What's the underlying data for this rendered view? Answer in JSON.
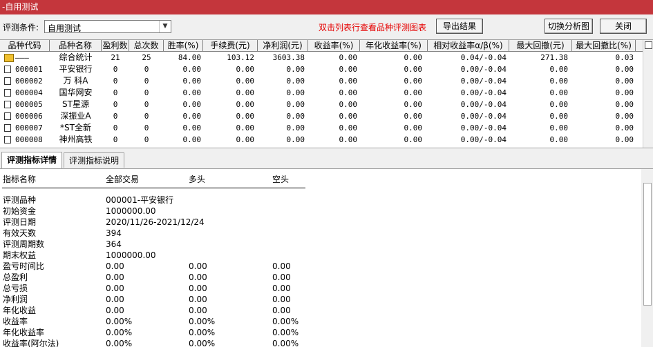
{
  "window": {
    "title": "-自用测试"
  },
  "toolbar": {
    "condition_label": "评测条件:",
    "condition_value": "自用测试",
    "hint": "双击列表行查看品种评测图表",
    "export_label": "导出结果",
    "switch_label": "切换分析图",
    "close_label": "关闭"
  },
  "table": {
    "columns": [
      "品种代码",
      "品种名称",
      "盈利数",
      "总次数",
      "胜率(%)",
      "手续费(元)",
      "净利润(元)",
      "收益率(%)",
      "年化收益率(%)",
      "相对收益率α/β(%)",
      "最大回撤(元)",
      "最大回撤比(%)"
    ],
    "rows": [
      {
        "code": "———",
        "name": "综合统计",
        "win": "21",
        "total": "25",
        "rate": "84.00",
        "fee": "103.12",
        "profit": "3603.38",
        "ret": "0.00",
        "annual": "0.00",
        "ab": "0.04/-0.04",
        "dd": "271.38",
        "ddr": "0.03",
        "summary": true
      },
      {
        "code": "000001",
        "name": "平安银行",
        "win": "0",
        "total": "0",
        "rate": "0.00",
        "fee": "0.00",
        "profit": "0.00",
        "ret": "0.00",
        "annual": "0.00",
        "ab": "0.00/-0.04",
        "dd": "0.00",
        "ddr": "0.00"
      },
      {
        "code": "000002",
        "name": "万 科A",
        "win": "0",
        "total": "0",
        "rate": "0.00",
        "fee": "0.00",
        "profit": "0.00",
        "ret": "0.00",
        "annual": "0.00",
        "ab": "0.00/-0.04",
        "dd": "0.00",
        "ddr": "0.00"
      },
      {
        "code": "000004",
        "name": "国华网安",
        "win": "0",
        "total": "0",
        "rate": "0.00",
        "fee": "0.00",
        "profit": "0.00",
        "ret": "0.00",
        "annual": "0.00",
        "ab": "0.00/-0.04",
        "dd": "0.00",
        "ddr": "0.00"
      },
      {
        "code": "000005",
        "name": "ST星源",
        "win": "0",
        "total": "0",
        "rate": "0.00",
        "fee": "0.00",
        "profit": "0.00",
        "ret": "0.00",
        "annual": "0.00",
        "ab": "0.00/-0.04",
        "dd": "0.00",
        "ddr": "0.00"
      },
      {
        "code": "000006",
        "name": "深振业A",
        "win": "0",
        "total": "0",
        "rate": "0.00",
        "fee": "0.00",
        "profit": "0.00",
        "ret": "0.00",
        "annual": "0.00",
        "ab": "0.00/-0.04",
        "dd": "0.00",
        "ddr": "0.00"
      },
      {
        "code": "000007",
        "name": "*ST全新",
        "win": "0",
        "total": "0",
        "rate": "0.00",
        "fee": "0.00",
        "profit": "0.00",
        "ret": "0.00",
        "annual": "0.00",
        "ab": "0.00/-0.04",
        "dd": "0.00",
        "ddr": "0.00"
      },
      {
        "code": "000008",
        "name": "神州高铁",
        "win": "0",
        "total": "0",
        "rate": "0.00",
        "fee": "0.00",
        "profit": "0.00",
        "ret": "0.00",
        "annual": "0.00",
        "ab": "0.00/-0.04",
        "dd": "0.00",
        "ddr": "0.00"
      }
    ]
  },
  "tabs": [
    "评测指标详情",
    "评测指标说明"
  ],
  "detail": {
    "headers": [
      "指标名称",
      "全部交易",
      "多头",
      "空头"
    ],
    "rows": [
      [
        "评测品种",
        "000001-平安银行",
        "",
        ""
      ],
      [
        "初始资金",
        "1000000.00",
        "",
        ""
      ],
      [
        "评测日期",
        "2020/11/26-2021/12/24",
        "",
        ""
      ],
      [
        "有效天数",
        "394",
        "",
        ""
      ],
      [
        "评测周期数",
        "364",
        "",
        ""
      ],
      [
        "期末权益",
        "1000000.00",
        "",
        ""
      ],
      [
        "盈亏时间比",
        "0.00",
        "0.00",
        "0.00"
      ],
      [
        "总盈利",
        "0.00",
        "0.00",
        "0.00"
      ],
      [
        "总亏损",
        "0.00",
        "0.00",
        "0.00"
      ],
      [
        "净利润",
        "0.00",
        "0.00",
        "0.00"
      ],
      [
        "年化收益",
        "0.00",
        "0.00",
        "0.00"
      ],
      [
        "收益率",
        "0.00%",
        "0.00%",
        "0.00%"
      ],
      [
        "年化收益率",
        "0.00%",
        "0.00%",
        "0.00%"
      ],
      [
        "收益率(阿尔法)",
        "0.00%",
        "0.00%",
        "0.00%"
      ]
    ]
  },
  "colors": {
    "titlebar": "#c4363c",
    "hint": "#e60000"
  }
}
